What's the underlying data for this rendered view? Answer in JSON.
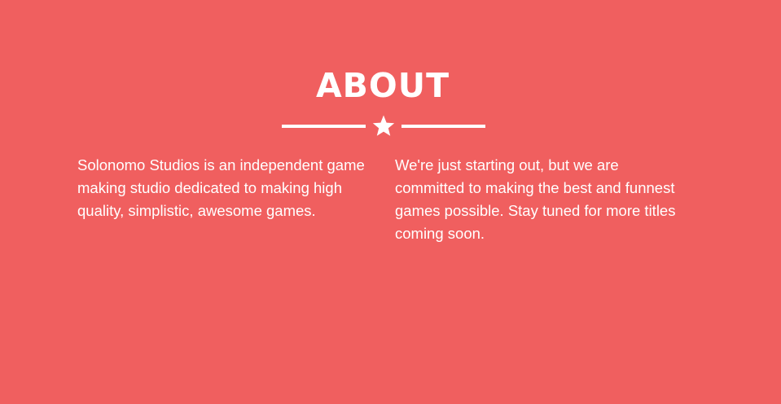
{
  "about": {
    "title": "ABOUT",
    "divider_icon": "star-icon",
    "paragraph_left": "Solonomo Studios is an independent game making studio dedicated to making high quality, simplistic, awesome games.",
    "paragraph_right": "We're just starting out, but we are committed to making the best and funnest games possible. Stay tuned for more titles coming soon."
  },
  "colors": {
    "background": "#f05f5f",
    "text": "#ffffff"
  }
}
